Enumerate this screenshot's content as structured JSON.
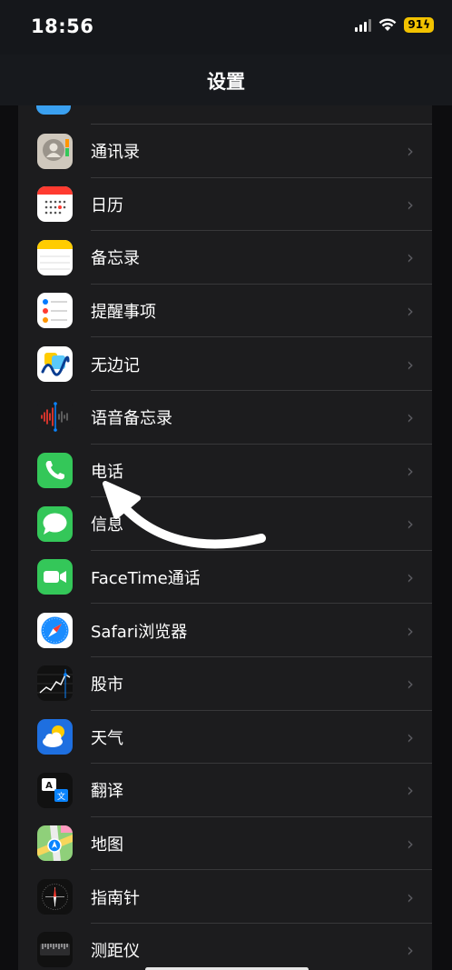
{
  "status_bar": {
    "time": "18:56",
    "battery": "91"
  },
  "nav": {
    "title": "设置"
  },
  "colors": {
    "background": "#0d0d0f",
    "list_bg": "#1c1c1e",
    "separator": "#38383a",
    "chevron": "#5b5b60",
    "battery": "#f2c200"
  },
  "items": [
    {
      "label": "通讯录",
      "icon": "contacts-icon"
    },
    {
      "label": "日历",
      "icon": "calendar-icon"
    },
    {
      "label": "备忘录",
      "icon": "notes-icon"
    },
    {
      "label": "提醒事项",
      "icon": "reminders-icon"
    },
    {
      "label": "无边记",
      "icon": "freeform-icon"
    },
    {
      "label": "语音备忘录",
      "icon": "voice-memos-icon"
    },
    {
      "label": "电话",
      "icon": "phone-icon"
    },
    {
      "label": "信息",
      "icon": "messages-icon"
    },
    {
      "label": "FaceTime通话",
      "icon": "facetime-icon"
    },
    {
      "label": "Safari浏览器",
      "icon": "safari-icon"
    },
    {
      "label": "股市",
      "icon": "stocks-icon"
    },
    {
      "label": "天气",
      "icon": "weather-icon"
    },
    {
      "label": "翻译",
      "icon": "translate-icon"
    },
    {
      "label": "地图",
      "icon": "maps-icon"
    },
    {
      "label": "指南针",
      "icon": "compass-icon"
    },
    {
      "label": "测距仪",
      "icon": "measure-icon"
    }
  ]
}
